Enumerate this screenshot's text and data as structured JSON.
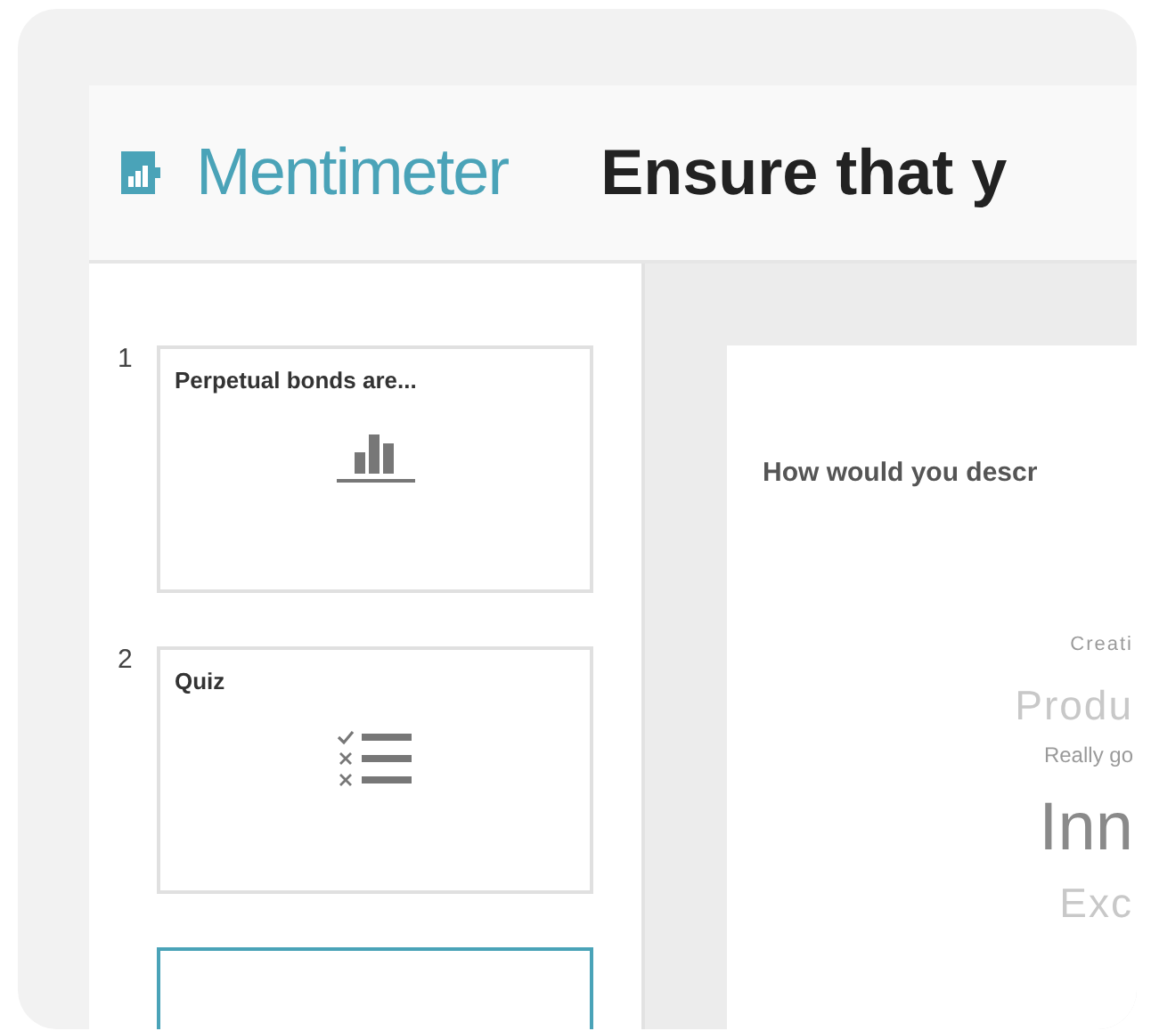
{
  "header": {
    "logo": "Mentimeter",
    "title": "Ensure that y"
  },
  "slides": [
    {
      "number": "1",
      "title": "Perpetual bonds are...",
      "kind": "bar",
      "selected": false
    },
    {
      "number": "2",
      "title": "Quiz",
      "kind": "quiz",
      "selected": false
    },
    {
      "kind": "blank",
      "selected": true
    }
  ],
  "slide": {
    "question": "How would you descr",
    "words": [
      {
        "text": "Creati",
        "kind": "tiny"
      },
      {
        "text": "Produ",
        "kind": "medium"
      },
      {
        "text": "Really go",
        "kind": "small"
      },
      {
        "text": "Inn",
        "kind": "large"
      },
      {
        "text": "Exc",
        "kind": "medium"
      }
    ]
  }
}
